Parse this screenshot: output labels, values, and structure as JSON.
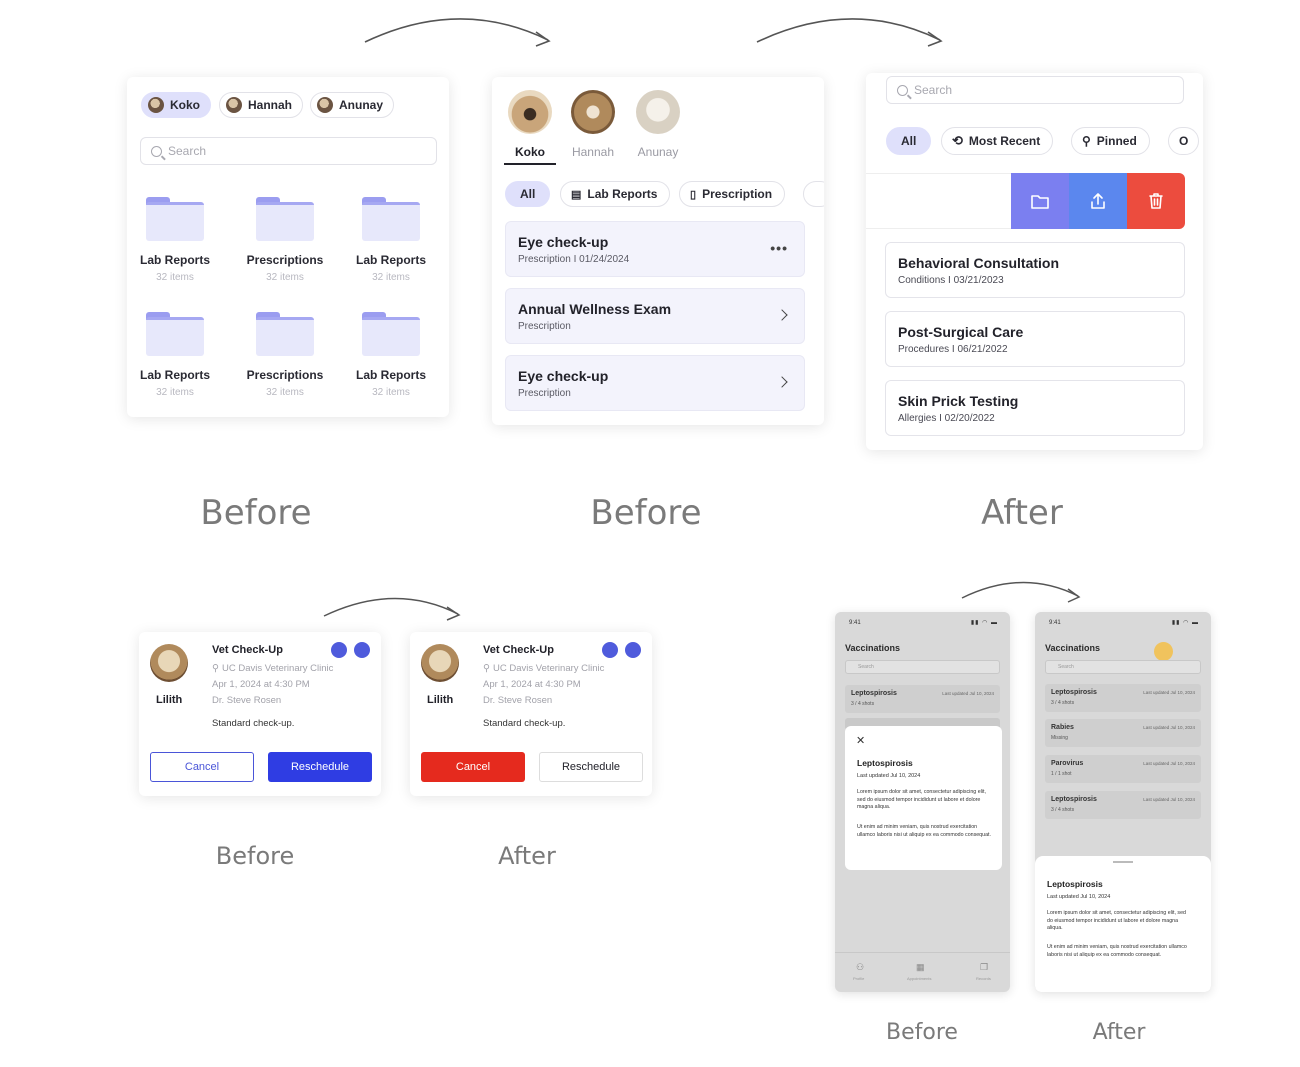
{
  "captions": {
    "top1": "Before",
    "top2": "Before",
    "top3": "After",
    "mid1": "Before",
    "mid2": "After",
    "bot1": "Before",
    "bot2": "After"
  },
  "panel1": {
    "chips": [
      "Koko",
      "Hannah",
      "Anunay"
    ],
    "search_placeholder": "Search",
    "folders": [
      {
        "label": "Lab Reports",
        "count": "32 items"
      },
      {
        "label": "Prescriptions",
        "count": "32 items"
      },
      {
        "label": "Lab Reports",
        "count": "32 items"
      },
      {
        "label": "Lab Reports",
        "count": "32 items"
      },
      {
        "label": "Prescriptions",
        "count": "32 items"
      },
      {
        "label": "Lab Reports",
        "count": "32 items"
      }
    ]
  },
  "panel2": {
    "pets": [
      "Koko",
      "Hannah",
      "Anunay"
    ],
    "filters": [
      "All",
      "Lab Reports",
      "Prescription"
    ],
    "records": [
      {
        "title": "Eye check-up",
        "sub": "Prescription  I  01/24/2024"
      },
      {
        "title": "Annual Wellness Exam",
        "sub": "Prescription"
      },
      {
        "title": "Eye check-up",
        "sub": "Prescription"
      }
    ]
  },
  "panel3": {
    "search_placeholder": "Search",
    "filters": [
      "All",
      "Most Recent",
      "Pinned",
      "O"
    ],
    "records": [
      {
        "title": "Behavioral Consultation",
        "sub": "Conditions  I  03/21/2023"
      },
      {
        "title": "Post-Surgical Care",
        "sub": "Procedures  I  06/21/2022"
      },
      {
        "title": "Skin Prick Testing",
        "sub": "Allergies  I  02/20/2022"
      }
    ],
    "colors": {
      "folder": "#7b7ff0",
      "share": "#5b87ee",
      "delete": "#ec4c3e"
    }
  },
  "appt_before": {
    "pet": "Lilith",
    "title": "Vet Check-Up",
    "clinic": "UC Davis Veterinary Clinic",
    "datetime": "Apr 1, 2024  at  4:30 PM",
    "doctor": "Dr. Steve Rosen",
    "note": "Standard check-up.",
    "cancel": "Cancel",
    "reschedule": "Reschedule"
  },
  "appt_after": {
    "pet": "Lilith",
    "title": "Vet Check-Up",
    "clinic": "UC Davis Veterinary Clinic",
    "datetime": "Apr 1, 2024  at  4:30 PM",
    "doctor": "Dr. Steve Rosen",
    "note": "Standard check-up.",
    "cancel": "Cancel",
    "reschedule": "Reschedule"
  },
  "phone_before": {
    "time": "9:41",
    "title": "Vaccinations",
    "search": "Search",
    "row": {
      "name": "Leptospirosis",
      "count": "3 / 4 shots",
      "updated": "Last updated Jul 10, 2024"
    },
    "sheet": {
      "title": "Leptospirosis",
      "updated": "Last updated Jul 10, 2024",
      "p1": "Lorem ipsum dolor sit amet, consectetur adipiscing elit, sed do eiusmod tempor incididunt ut labore et dolore magna aliqua.",
      "p2": "Ut enim ad minim veniam, quis nostrud exercitation ullamco laboris nisi ut aliquip ex ea commodo consequat."
    },
    "tabs": [
      "Profile",
      "Appointments",
      "Records"
    ]
  },
  "phone_after": {
    "time": "9:41",
    "title": "Vaccinations",
    "search": "Search",
    "rows": [
      {
        "name": "Leptospirosis",
        "count": "3 / 4 shots",
        "updated": "Last updated Jul 10, 2024"
      },
      {
        "name": "Rabies",
        "count": "Missing",
        "updated": "Last updated Jul 10, 2024"
      },
      {
        "name": "Parovirus",
        "count": "1 / 1 shot",
        "updated": "Last updated Jul 10, 2024"
      },
      {
        "name": "Leptospirosis",
        "count": "3 / 4 shots",
        "updated": "Last updated Jul 10, 2024"
      }
    ],
    "sheet": {
      "title": "Leptospirosis",
      "updated": "Last updated Jul 10, 2024",
      "p1": "Lorem ipsum dolor sit amet, consectetur adipiscing elit, sed do eiusmod tempor incididunt ut labore et dolore magna aliqua.",
      "p2": "Ut enim ad minim veniam, quis nostrud exercitation ullamco laboris nisi ut aliquip ex ea commodo consequat."
    }
  }
}
